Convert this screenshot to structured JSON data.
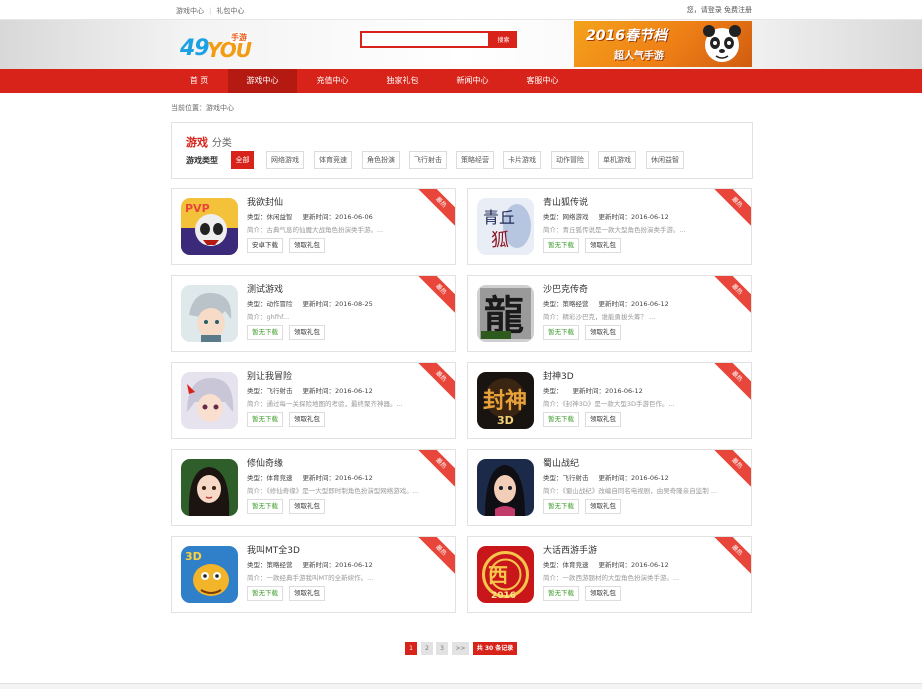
{
  "topbar": {
    "links": [
      "游戏中心",
      "礼包中心"
    ],
    "right_text": "您，请登录 免费注册"
  },
  "header": {
    "logo_num": "49",
    "logo_you": "YOU",
    "logo_tag": "手游",
    "search_placeholder": "",
    "search_button": "搜索",
    "banner_line1": "2016春节档",
    "banner_line2": "超人气手游",
    "banner_icon": "panda-icon"
  },
  "nav": {
    "items": [
      "首 页",
      "游戏中心",
      "充值中心",
      "独家礼包",
      "新闻中心",
      "客服中心"
    ],
    "active_index": 1
  },
  "breadcrumb": "当前位置：游戏中心",
  "category": {
    "title": "游戏",
    "title_sub": "分类",
    "label": "游戏类型",
    "chips": [
      "全部",
      "网络游戏",
      "体育竞速",
      "角色扮演",
      "飞行射击",
      "策略经营",
      "卡片游戏",
      "动作冒险",
      "单机游戏",
      "休闲益智"
    ],
    "active_index": 0
  },
  "games": [
    {
      "name": "我欲封仙",
      "type": "类型：休闲益智",
      "updated": "更新时间：2016-06-06",
      "desc": "简介：古典气息的仙魔大战角色扮演类手游。...",
      "download": "安卓下载",
      "gift": "领取礼包",
      "ribbon": "最热",
      "icon": "pvp-panda-icon"
    },
    {
      "name": "青山狐传说",
      "type": "类型：网络游戏",
      "updated": "更新时间：2016-06-12",
      "desc": "简介：青丘狐传说是一款大型角色扮演类手游。...",
      "download": "暂无下载",
      "gift": "领取礼包",
      "ribbon": "最热",
      "icon": "fox-calligraphy-icon"
    },
    {
      "name": "测试游戏",
      "type": "类型：动作冒险",
      "updated": "更新时间：2016-08-25",
      "desc": "简介：ghfhf...",
      "download": "暂无下载",
      "gift": "领取礼包",
      "ribbon": "最热",
      "icon": "anime-boy-icon"
    },
    {
      "name": "沙巴克传奇",
      "type": "类型：策略经营",
      "updated": "更新时间：2016-06-12",
      "desc": "简介：精彩沙巴克，谁能勇拔头筹？ ...",
      "download": "暂无下载",
      "gift": "领取礼包",
      "ribbon": "最热",
      "icon": "dragon-character-icon"
    },
    {
      "name": "别让我冒险",
      "type": "类型：飞行射击",
      "updated": "更新时间：2016-06-12",
      "desc": "简介：通过每一关探险地图的考验，最终聚齐神器。...",
      "download": "暂无下载",
      "gift": "领取礼包",
      "ribbon": "最热",
      "icon": "anime-girl-icon"
    },
    {
      "name": "封神3D",
      "type": "类型：",
      "updated": "更新时间：2016-06-12",
      "desc": "简介：《封神3D》是一款大型3D手游巨作。...",
      "download": "暂无下载",
      "gift": "领取礼包",
      "ribbon": "最热",
      "icon": "fengshen-3d-icon"
    },
    {
      "name": "修仙奇缘",
      "type": "类型：体育竞速",
      "updated": "更新时间：2016-06-12",
      "desc": "简介：《修仙奇缘》是一大型即时制角色扮演型网络游戏。...",
      "download": "暂无下载",
      "gift": "领取礼包",
      "ribbon": "最热",
      "icon": "fairy-lady-icon"
    },
    {
      "name": "蜀山战纪",
      "type": "类型：飞行射击",
      "updated": "更新时间：2016-06-12",
      "desc": "简介：《蜀山战纪》改编自同名电视剧，由吴奇隆亲自监制 ...",
      "download": "暂无下载",
      "gift": "领取礼包",
      "ribbon": "最热",
      "icon": "heroine-icon"
    },
    {
      "name": "我叫MT全3D",
      "type": "类型：策略经营",
      "updated": "更新时间：2016-06-12",
      "desc": "简介：一款经典手游我叫MT的全新续作。...",
      "download": "暂无下载",
      "gift": "领取礼包",
      "ribbon": "最热",
      "icon": "mt-cow-icon"
    },
    {
      "name": "大话西游手游",
      "type": "类型：体育竞速",
      "updated": "更新时间：2016-06-12",
      "desc": "简介：一款西游题材的大型角色扮演类手游。...",
      "download": "暂无下载",
      "gift": "领取礼包",
      "ribbon": "最热",
      "icon": "xiyou-2016-icon"
    }
  ],
  "pagination": {
    "pages": [
      "1",
      "2",
      "3",
      ">>"
    ],
    "active_index": 0,
    "total": "共 30 条记录"
  }
}
